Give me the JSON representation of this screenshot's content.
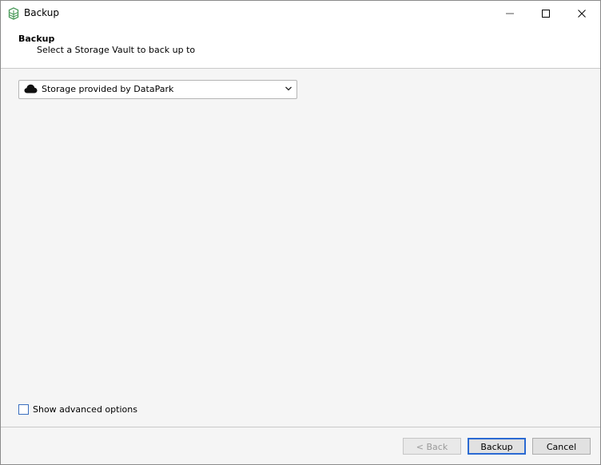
{
  "window": {
    "title": "Backup"
  },
  "header": {
    "title": "Backup",
    "subtitle": "Select a Storage Vault to back up to"
  },
  "vault_select": {
    "selected": "Storage provided by DataPark",
    "icon": "cloud-icon"
  },
  "advanced": {
    "label": "Show advanced options",
    "checked": false
  },
  "buttons": {
    "back": "< Back",
    "backup": "Backup",
    "cancel": "Cancel"
  },
  "colors": {
    "accent": "#2b6ad2",
    "app_icon": "#4a9a5a",
    "window_bg": "#f5f5f5"
  }
}
